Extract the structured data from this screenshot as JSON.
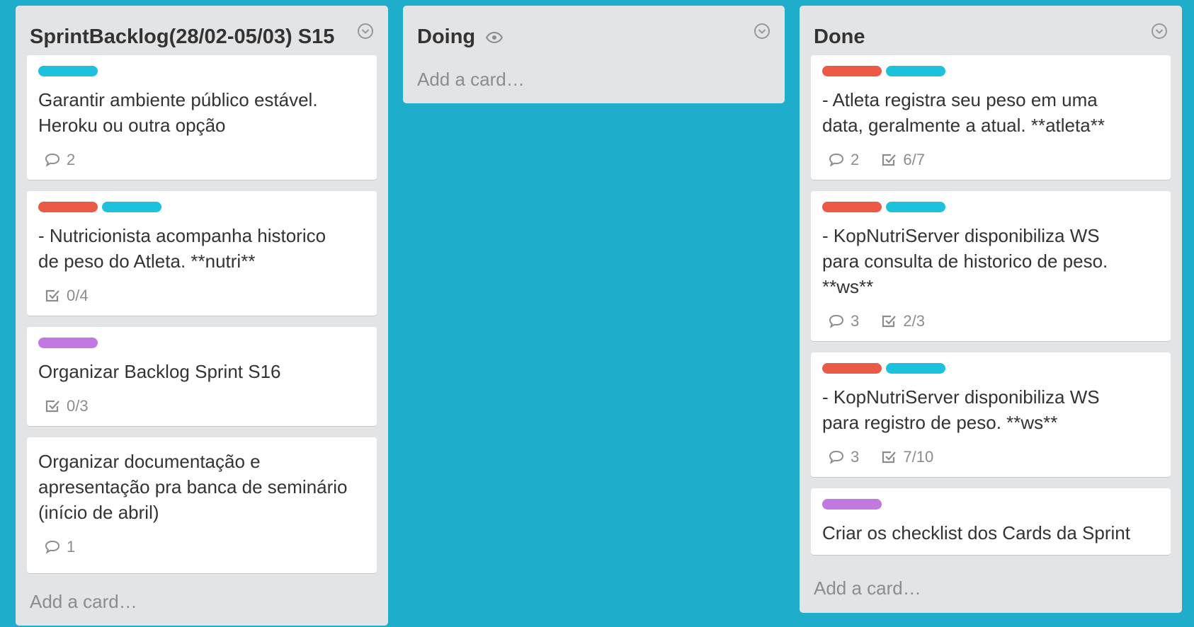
{
  "colors": {
    "board_bg": "#1fadcc",
    "list_bg": "#e2e4e6",
    "label_red": "#eb5a46",
    "label_blue": "#1cc2dd",
    "label_purple": "#c377e0"
  },
  "lists": [
    {
      "title": "SprintBacklog(28/02-05/03) S15",
      "add_card": "Add a card…",
      "cards": [
        {
          "labels": [
            "blue"
          ],
          "title_lines": [
            "Garantir ambiente público estável.",
            "Heroku ou outra opção"
          ],
          "comments": "2",
          "checklist": null
        },
        {
          "labels": [
            "red",
            "blue"
          ],
          "title_lines": [
            "- Nutricionista acompanha historico",
            "de peso do Atleta. **nutri**"
          ],
          "comments": null,
          "checklist": "0/4"
        },
        {
          "labels": [
            "purple"
          ],
          "title_lines": [
            "Organizar Backlog Sprint S16"
          ],
          "comments": null,
          "checklist": "0/3"
        },
        {
          "labels": [],
          "title_lines": [
            "Organizar documentação e",
            "apresentação pra banca de seminário",
            "(início de abril)"
          ],
          "comments": "1",
          "checklist": null
        }
      ]
    },
    {
      "title": "Doing",
      "add_card": "Add a card…",
      "cards": []
    },
    {
      "title": "Done",
      "add_card": "Add a card…",
      "cards": [
        {
          "labels": [
            "red",
            "blue"
          ],
          "title_lines": [
            "- Atleta registra seu peso em uma",
            "data, geralmente a atual. **atleta**"
          ],
          "comments": "2",
          "checklist": "6/7"
        },
        {
          "labels": [
            "red",
            "blue"
          ],
          "title_lines": [
            "- KopNutriServer disponibiliza WS",
            "para consulta de historico de peso.",
            "**ws**"
          ],
          "comments": "3",
          "checklist": "2/3"
        },
        {
          "labels": [
            "red",
            "blue"
          ],
          "title_lines": [
            "- KopNutriServer disponibiliza WS",
            "para registro de peso. **ws**"
          ],
          "comments": "3",
          "checklist": "7/10"
        },
        {
          "labels": [
            "purple"
          ],
          "title_lines": [
            "Criar os checklist dos Cards da Sprint"
          ],
          "comments": null,
          "checklist": null
        }
      ]
    }
  ]
}
